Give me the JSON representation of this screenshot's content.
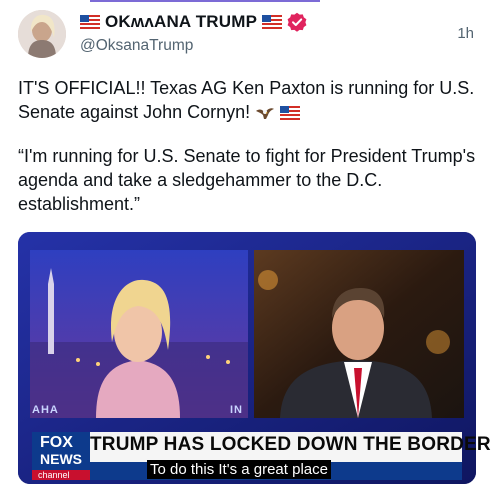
{
  "post": {
    "display_name": "OKʍʌANA TRUMP",
    "handle": "@OksanaTrump",
    "time": "1h",
    "paragraph_1": "IT'S OFFICIAL!! Texas AG Ken Paxton is running for U.S. Senate against John Cornyn!",
    "paragraph_2": "“I'm running for U.S. Senate to fight for President Trump's agenda and take a sledgehammer to the D.C. establishment.”",
    "icons": [
      "us-flag-icon",
      "verified-badge-icon",
      "eagle-icon",
      "us-flag-icon"
    ]
  },
  "video": {
    "chyron": "TRUMP HAS LOCKED DOWN THE BORDER",
    "caption": "To do this It's a great place",
    "logo_line1": "FOX",
    "logo_line2": "NEWS",
    "logo_line3": "channel",
    "studio_left": "AHA",
    "studio_right": "IN"
  },
  "colors": {
    "accent": "#7c6bd6",
    "verified": "#e0245e",
    "muted": "#536471",
    "fox_blue": "#0d3a8c"
  }
}
